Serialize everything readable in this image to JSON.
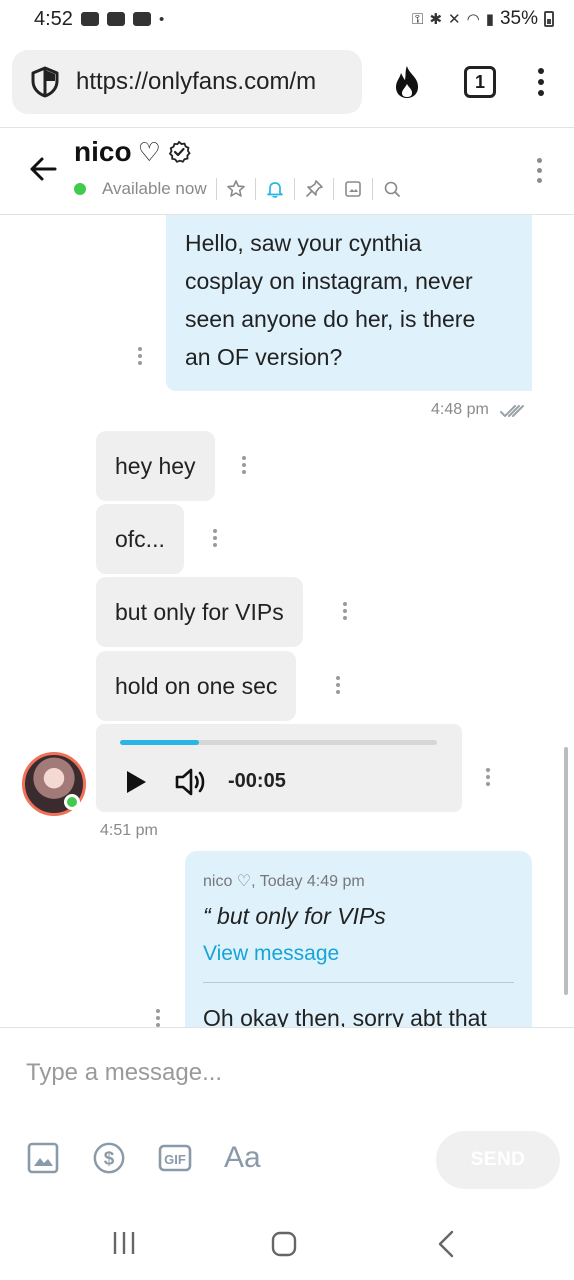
{
  "status_bar": {
    "time": "4:52",
    "battery_percent": "35%"
  },
  "browser": {
    "url": "https://onlyfans.com/m",
    "tab_count": "1"
  },
  "chat": {
    "name": "nico",
    "name_symbol": "♡",
    "status": "Available now"
  },
  "messages": {
    "outgoing_1": {
      "lines": [
        "Hello, saw your cynthia",
        "cosplay on instagram, never",
        "seen anyone do her, is there",
        "an OF version?"
      ],
      "time": "4:48 pm"
    },
    "incoming": [
      "hey hey",
      "ofc...",
      "but only for VIPs",
      "hold on one sec"
    ],
    "audio": {
      "duration": "-00:05",
      "progress": 0.25
    },
    "incoming_time": "4:51 pm",
    "reply": {
      "meta": "nico ♡, Today 4:49 pm",
      "quote": "“ but only for VIPs",
      "link": "View message",
      "text": "Oh okay then, sorry abt that"
    }
  },
  "composer": {
    "placeholder": "Type a message...",
    "aa_label": "Aa",
    "send_label": "SEND"
  },
  "colors": {
    "accent": "#29b6e6",
    "outgoing_bubble": "#dff2fc",
    "incoming_bubble": "#efefef",
    "online": "#3fcb4b",
    "link": "#16a4d8"
  },
  "icons": [
    "shield-icon",
    "fire-icon",
    "back-arrow-icon",
    "verified-icon",
    "star-icon",
    "bell-icon",
    "pin-icon",
    "image-icon",
    "search-icon",
    "play-icon",
    "volume-icon",
    "dollar-icon",
    "gif-icon"
  ]
}
